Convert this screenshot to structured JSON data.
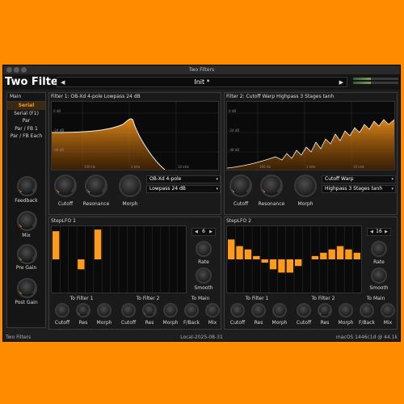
{
  "window": {
    "title": "Two Filters"
  },
  "header": {
    "brand": "Two Filters",
    "preset": "Init *",
    "prev_arrow": "◀",
    "next_arrow": "▶"
  },
  "colors": {
    "accent": "#ff9a1a",
    "background": "#ff8c00"
  },
  "sidebar": {
    "title": "Main",
    "routing": [
      "Serial",
      "Serial (F1)",
      "Par",
      "Par / FB 1",
      "Par / FB Each"
    ],
    "selected": "Serial",
    "knobs": [
      {
        "label": "Feedback",
        "value": 0.08
      },
      {
        "label": "Mix",
        "value": 0.3
      },
      {
        "label": "Pre Gain",
        "value": 0.5
      },
      {
        "label": "Post Gain",
        "value": 0.5
      }
    ]
  },
  "filter1": {
    "title": "Filter 1: OB-Xd 4-pole Lowpass 24 dB",
    "model": "OB-Xd 4-pole",
    "mode": "Lowpass 24 dB",
    "knobs": [
      {
        "label": "Cutoff",
        "value": 0.55
      },
      {
        "label": "Resonance",
        "value": 0.7
      },
      {
        "label": "Morph",
        "value": 0.0
      }
    ],
    "db_labels": [
      "0 dB",
      "-24 dB",
      "-48 dB"
    ],
    "freq_labels": [
      "100 Hz",
      "1 kHz",
      "10 kHz"
    ]
  },
  "filter2": {
    "title": "Filter 2: Cutoff Warp Highpass 3 Stages tanh",
    "model": "Cutoff Warp",
    "mode": "Highpass 3 Stages tanh",
    "knobs": [
      {
        "label": "Cutoff",
        "value": 0.55
      },
      {
        "label": "Resonance",
        "value": 0.7
      },
      {
        "label": "Morph",
        "value": 0.0
      }
    ],
    "db_labels": [
      "0 dB",
      "-24 dB",
      "-48 dB"
    ],
    "freq_labels": [
      "100 Hz",
      "1 kHz",
      "10 kHz"
    ]
  },
  "lfo1": {
    "title": "StepLFO 1",
    "steps": "6",
    "step_values": [
      0.85,
      0,
      0,
      -0.3,
      0,
      0.9,
      0,
      0,
      0,
      0,
      0,
      0,
      0,
      0,
      0,
      0
    ],
    "rate_label": "Rate",
    "smooth_label": "Smooth",
    "groups": [
      {
        "title": "To Filter 1",
        "knobs": [
          {
            "label": "Cutoff",
            "value": 0.0
          },
          {
            "label": "Res",
            "value": 0.1
          }
        ]
      },
      {
        "title": "",
        "knobs": [
          {
            "label": "Morph",
            "value": 0.0
          }
        ]
      },
      {
        "title": "To Filter 2",
        "knobs": [
          {
            "label": "Cutoff",
            "value": 0.0
          },
          {
            "label": "Res",
            "value": 0.1
          },
          {
            "label": "Morph",
            "value": 0.0
          }
        ]
      },
      {
        "title": "To Main",
        "knobs": [
          {
            "label": "F/Back",
            "value": 0.0
          },
          {
            "label": "Mix",
            "value": 0.0
          }
        ]
      }
    ]
  },
  "lfo2": {
    "title": "StepLFO 2",
    "steps": "16",
    "step_values": [
      0.6,
      0.4,
      0.3,
      0.1,
      -0.1,
      -0.3,
      -0.4,
      -0.4,
      -0.2,
      0.0,
      0.1,
      0.2,
      0.3,
      0.4,
      0.3,
      0.2
    ],
    "rate_label": "Rate",
    "smooth_label": "Smooth",
    "groups": [
      {
        "title": "To Filter 1",
        "knobs": [
          {
            "label": "Cutoff",
            "value": 0.0
          },
          {
            "label": "Res",
            "value": 0.0
          }
        ]
      },
      {
        "title": "",
        "knobs": [
          {
            "label": "Morph",
            "value": 0.0
          }
        ]
      },
      {
        "title": "To Filter 2",
        "knobs": [
          {
            "label": "Cutoff",
            "value": 0.0
          },
          {
            "label": "Res",
            "value": 0.1
          },
          {
            "label": "Morph",
            "value": 0.0
          }
        ]
      },
      {
        "title": "To Main",
        "knobs": [
          {
            "label": "F/Back",
            "value": 0.0
          },
          {
            "label": "Mix",
            "value": 0.0
          }
        ]
      }
    ]
  },
  "footer": {
    "left": "Two Filters",
    "center": "Local-2025-08-31",
    "right": "macOS 1446c1d @ 44.1k"
  }
}
